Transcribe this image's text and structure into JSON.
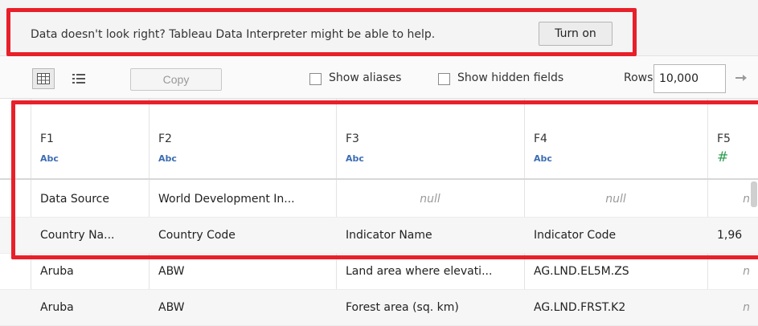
{
  "interpreter": {
    "message": "Data doesn't look right? Tableau Data Interpreter might be able to help.",
    "button_label": "Turn on"
  },
  "toolbar": {
    "grid_view_icon": "grid-view-icon",
    "list_view_icon": "list-view-icon",
    "copy_label": "Copy",
    "show_aliases_label": "Show aliases",
    "show_aliases_checked": false,
    "show_hidden_label": "Show hidden fields",
    "show_hidden_checked": false,
    "rows_label": "Rows",
    "rows_value": "10,000",
    "go_icon": "arrow-right-icon"
  },
  "grid": {
    "columns": [
      {
        "name": "F1",
        "type": "Abc"
      },
      {
        "name": "F2",
        "type": "Abc"
      },
      {
        "name": "F3",
        "type": "Abc"
      },
      {
        "name": "F4",
        "type": "Abc"
      },
      {
        "name": "F5",
        "type": "#"
      }
    ],
    "rows": [
      [
        "Data Source",
        "World Development In...",
        "null",
        "null",
        "n"
      ],
      [
        "Country Na...",
        "Country Code",
        "Indicator Name",
        "Indicator Code",
        "1,96"
      ],
      [
        "Aruba",
        "ABW",
        "Land area where elevati...",
        "AG.LND.EL5M.ZS",
        "n"
      ],
      [
        "Aruba",
        "ABW",
        "Forest area (sq. km)",
        "AG.LND.FRST.K2",
        "n"
      ]
    ]
  },
  "highlight_color": "#e8202a"
}
